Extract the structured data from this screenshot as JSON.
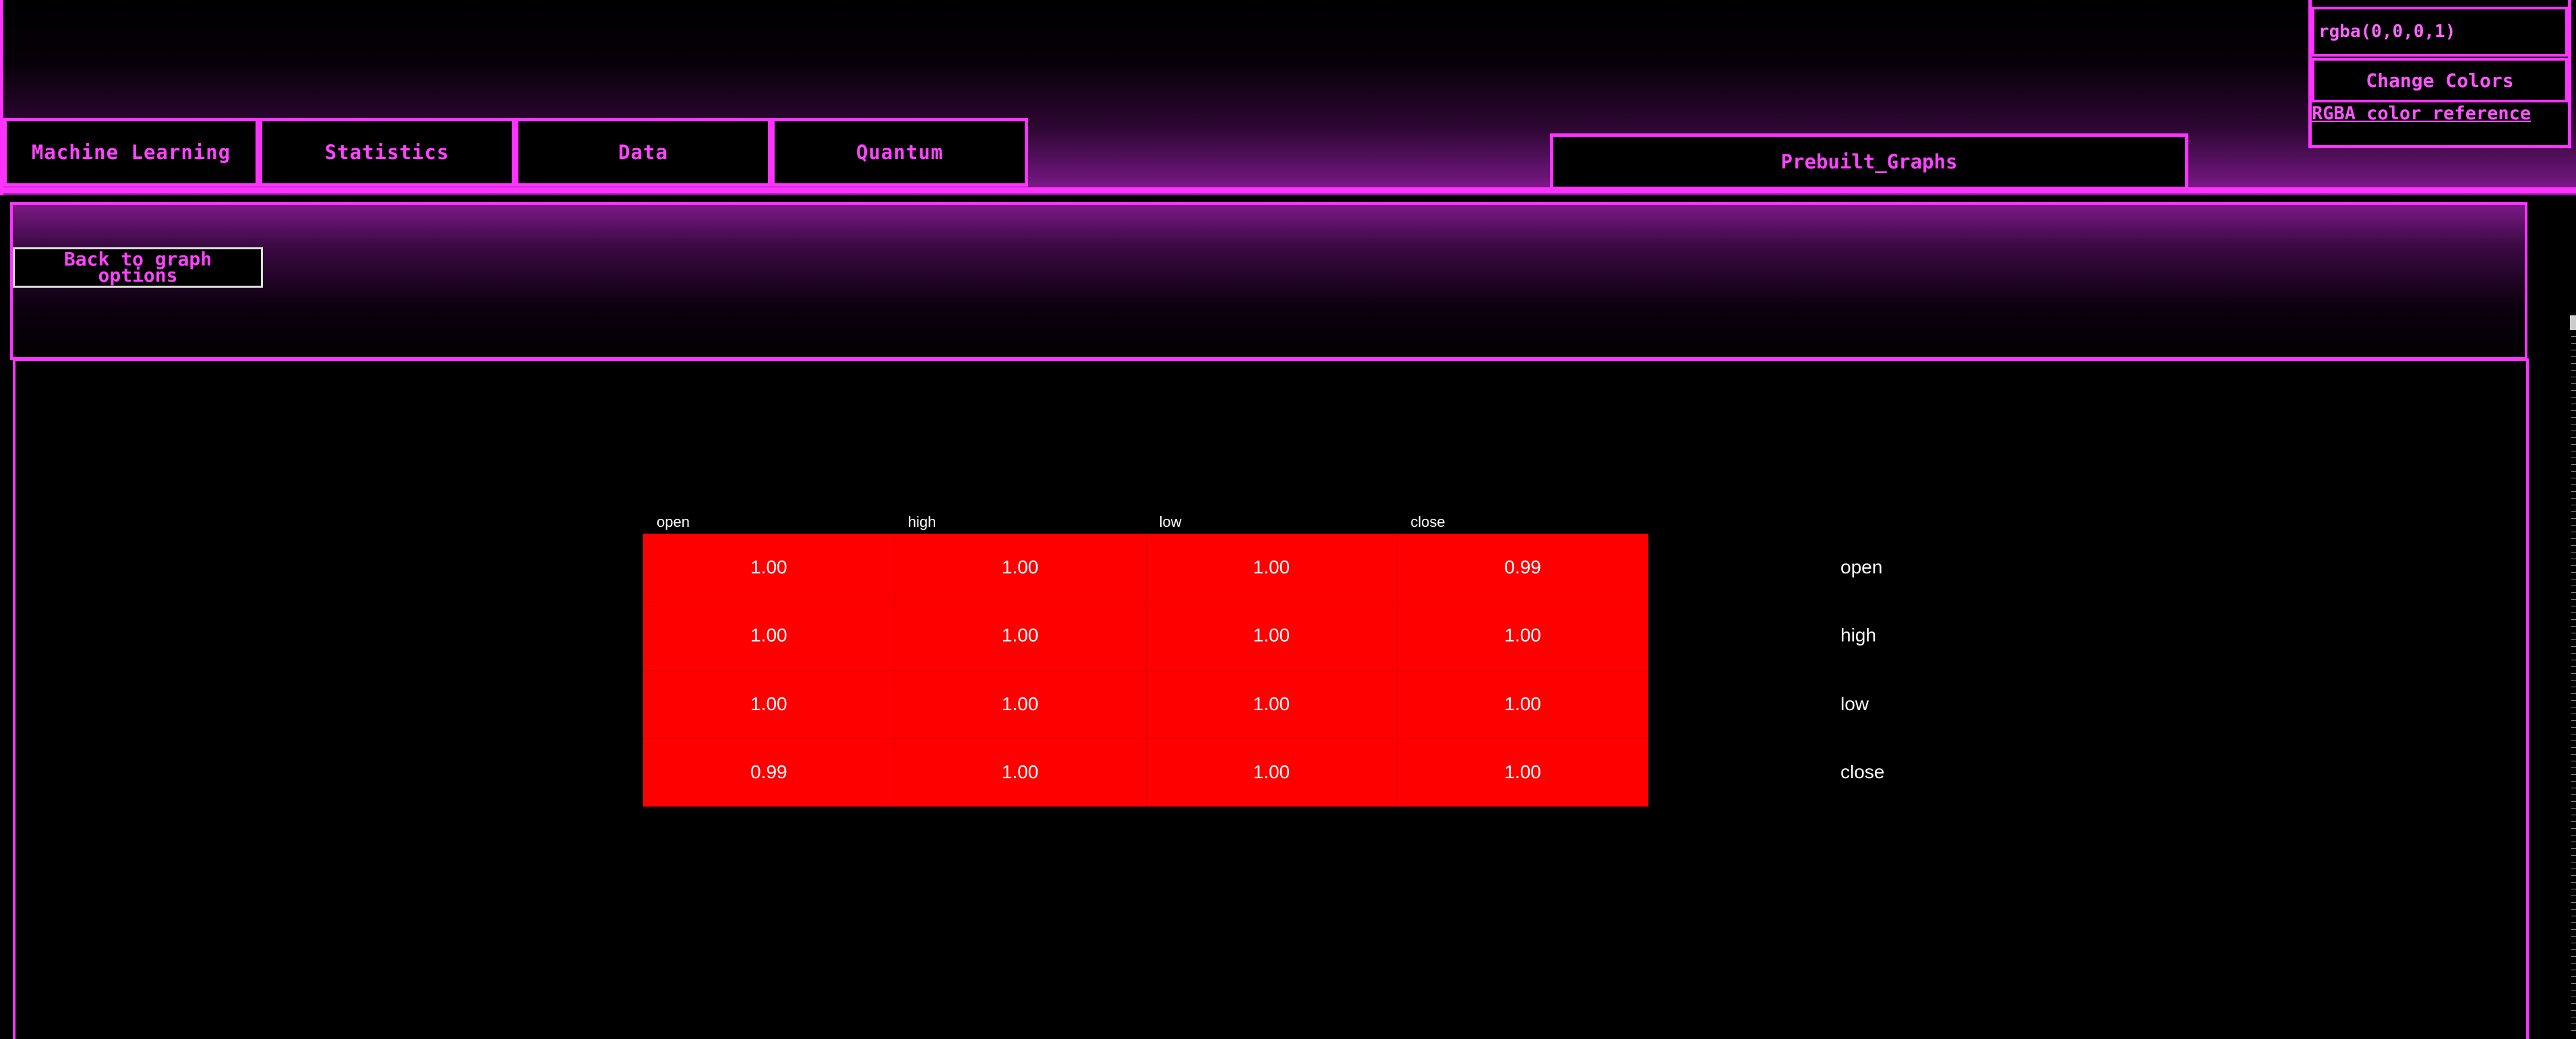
{
  "nav": {
    "tabs": [
      {
        "label": "Machine Learning"
      },
      {
        "label": "Statistics"
      },
      {
        "label": "Data"
      },
      {
        "label": "Quantum"
      }
    ],
    "prebuilt_label": "Prebuilt_Graphs"
  },
  "color_panel": {
    "input_value": "rgba(0,0,0,1)",
    "change_label": "Change Colors",
    "reference_link": "RGBA color reference"
  },
  "graph_panel": {
    "back_label": "Back to graph options"
  },
  "colors": {
    "accent": "#ff33ff",
    "heatmap_cell": "#ff0000",
    "background": "#000000"
  },
  "chart_data": {
    "type": "heatmap",
    "x": [
      "open",
      "high",
      "low",
      "close"
    ],
    "y": [
      "open",
      "high",
      "low",
      "close"
    ],
    "values": [
      [
        "1.00",
        "1.00",
        "1.00",
        "0.99"
      ],
      [
        "1.00",
        "1.00",
        "1.00",
        "1.00"
      ],
      [
        "1.00",
        "1.00",
        "1.00",
        "1.00"
      ],
      [
        "0.99",
        "1.00",
        "1.00",
        "1.00"
      ]
    ]
  }
}
